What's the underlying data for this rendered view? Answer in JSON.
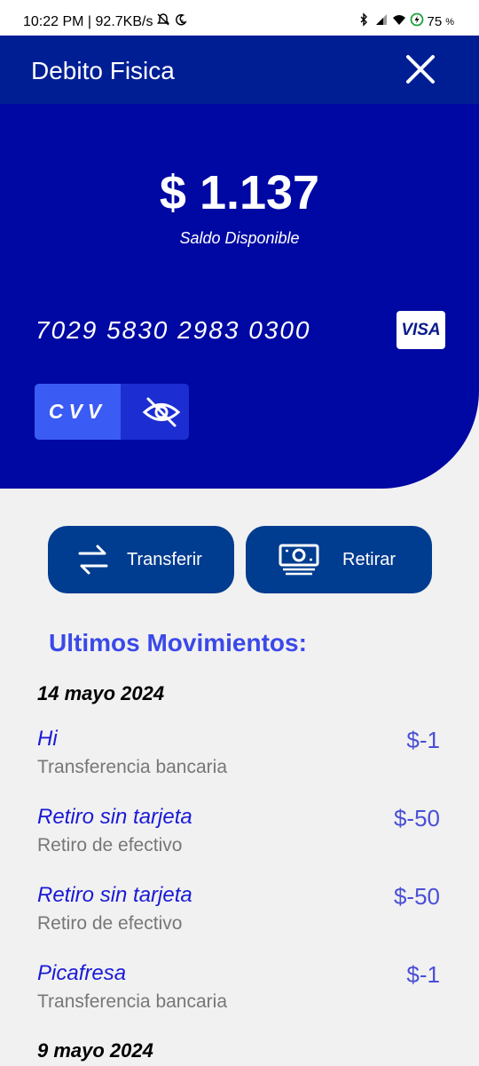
{
  "status_bar": {
    "time_speed": "10:22 PM | 92.7KB/s",
    "battery": "75",
    "battery_unit": "%",
    "icons": [
      "mute-icon",
      "alarm-icon",
      "bluetooth-icon",
      "signal-icon",
      "wifi-icon",
      "battery-charging-icon"
    ]
  },
  "header": {
    "title": "Debito Fisica",
    "close_icon": "close-icon"
  },
  "card": {
    "balance": "$ 1.137",
    "balance_label": "Saldo Disponible",
    "number": "7029 5830 2983 0300",
    "brand": "VISA",
    "cvv_label": "CVV",
    "cvv_toggle_icon": "eye-off-icon"
  },
  "actions": {
    "transfer_label": "Transferir",
    "transfer_icon": "swap-arrows-icon",
    "withdraw_label": "Retirar",
    "withdraw_icon": "cash-icon"
  },
  "movements": {
    "title": "Ultimos Movimientos:",
    "groups": [
      {
        "date": "14 mayo 2024",
        "items": [
          {
            "name": "Hi",
            "type": "Transferencia bancaria",
            "amount": "$-1"
          },
          {
            "name": "Retiro sin tarjeta",
            "type": "Retiro de efectivo",
            "amount": "$-50"
          },
          {
            "name": "Retiro sin tarjeta",
            "type": "Retiro de efectivo",
            "amount": "$-50"
          },
          {
            "name": "Picafresa",
            "type": "Transferencia bancaria",
            "amount": "$-1"
          }
        ]
      },
      {
        "date": "9 mayo 2024",
        "items": []
      }
    ]
  },
  "colors": {
    "header_bg": "#001e94",
    "card_bg": "#0008a3",
    "button_bg": "#003c8f",
    "accent_title": "#3b49e8",
    "tx_name": "#1a1ad6",
    "tx_amount": "#4a4fd6",
    "cvv_label_bg": "#3a5bf4"
  }
}
